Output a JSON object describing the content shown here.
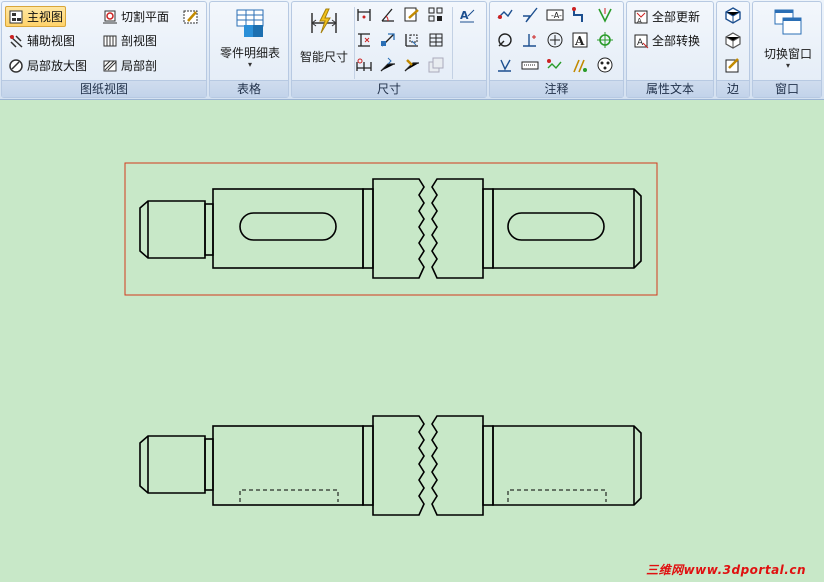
{
  "ribbon": {
    "drawing_views": {
      "label": "图纸视图",
      "main_view": "主视图",
      "aux_view": "辅助视图",
      "detail_view": "局部放大图",
      "cut_plane": "切割平面",
      "section_view": "剖视图",
      "partial_section": "局部剖"
    },
    "table": {
      "label": "表格",
      "parts_list": "零件明细表"
    },
    "dimension": {
      "label": "尺寸",
      "smart_dim": "智能尺寸"
    },
    "annotation": {
      "label": "注释"
    },
    "property_text": {
      "label": "属性文本",
      "update_all": "全部更新",
      "convert_all": "全部转换"
    },
    "edge": {
      "label": "边"
    },
    "window": {
      "label": "窗口",
      "switch_window": "切换窗口"
    }
  },
  "watermark": "三维网www.3dportal.cn",
  "colors": {
    "canvas": "#c8e8c8",
    "selection": "#d23a1c",
    "line": "#000000"
  }
}
